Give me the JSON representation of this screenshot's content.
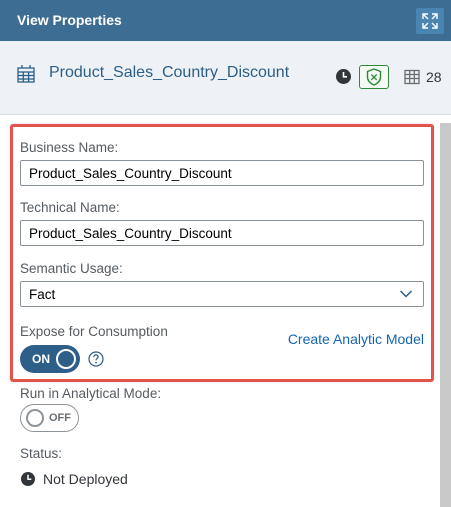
{
  "header": {
    "title": "View Properties",
    "expand_icon": "expand-icon"
  },
  "object": {
    "name": "Product_Sales_Country_Discount",
    "icon": "table-icon",
    "column_count": "28",
    "shield_color": "#2e8a3a"
  },
  "form": {
    "business_name_label": "Business Name:",
    "business_name_value": "Product_Sales_Country_Discount",
    "technical_name_label": "Technical Name:",
    "technical_name_value": "Product_Sales_Country_Discount",
    "semantic_usage_label": "Semantic Usage:",
    "semantic_usage_value": "Fact",
    "expose_label": "Expose for Consumption",
    "expose_toggle": "ON",
    "create_model_link": "Create Analytic Model",
    "analytical_mode_label": "Run in Analytical Mode:",
    "analytical_mode_toggle": "OFF",
    "status_label": "Status:",
    "status_value": "Not Deployed"
  },
  "colors": {
    "header_bg": "#3d6d92",
    "highlight": "#e2554d",
    "link": "#1465b0",
    "toggle_on": "#2e5f88"
  }
}
